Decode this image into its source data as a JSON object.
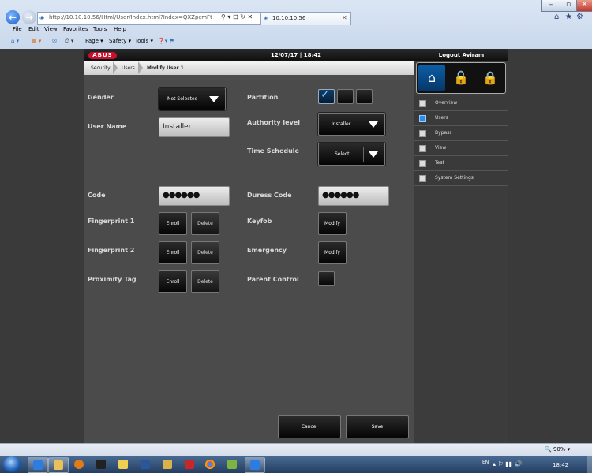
{
  "browser": {
    "url": "http://10.10.10.56/Html/User/Index.html?Index=QXZpcmFt",
    "tab_title": "10.10.10.56",
    "menu": [
      "File",
      "Edit",
      "View",
      "Favorites",
      "Tools",
      "Help"
    ],
    "commands": [
      "Page ▾",
      "Safety ▾",
      "Tools ▾"
    ],
    "zoom": "🔍 90%  ▾",
    "window_controls": [
      "–",
      "▫",
      "✕"
    ]
  },
  "header": {
    "logo": "ABUS",
    "datetime": "12/07/17  |  18:42",
    "logout": "Logout Aviram"
  },
  "breadcrumb": [
    "Security",
    "Users",
    "Modify User 1"
  ],
  "form": {
    "gender_label": "Gender",
    "gender_value": "Not Selected",
    "username_label": "User Name",
    "username_value": "Installer",
    "code_label": "Code",
    "code_value": "●●●●●●",
    "fp1_label": "Fingerprint 1",
    "fp2_label": "Fingerprint 2",
    "prox_label": "Proximity Tag",
    "enroll": "Enroll",
    "delete": "Delete",
    "partition_label": "Partition",
    "authority_label": "Authority level",
    "authority_value": "Installer",
    "schedule_label": "Time Schedule",
    "schedule_value": "Select",
    "duress_label": "Duress Code",
    "duress_value": "●●●●●●",
    "keyfob_label": "Keyfob",
    "emergency_label": "Emergency",
    "parent_label": "Parent Control",
    "modify": "Modify",
    "partitions_checked": [
      true,
      false,
      false
    ],
    "parent_control_checked": false
  },
  "actions": {
    "cancel": "Cancel",
    "save": "Save"
  },
  "sidebar": {
    "items": [
      {
        "label": "Overview",
        "active": false
      },
      {
        "label": "Users",
        "active": true
      },
      {
        "label": "Bypass",
        "active": false
      },
      {
        "label": "View",
        "active": false
      },
      {
        "label": "Test",
        "active": false
      },
      {
        "label": "System Settings",
        "active": false
      }
    ],
    "modes": [
      "home-lock-icon",
      "partial-lock-icon",
      "full-lock-icon"
    ]
  },
  "taskbar": {
    "language": "EN",
    "clock": "18:42"
  },
  "colors": {
    "accent": "#0d5fa8",
    "brand": "#c8102e"
  }
}
